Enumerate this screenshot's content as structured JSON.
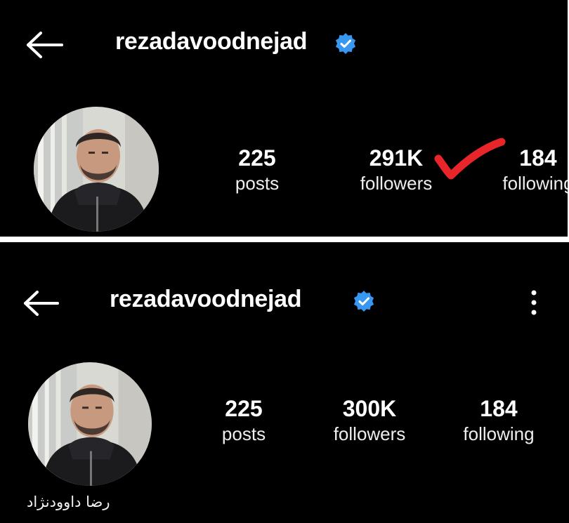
{
  "screens": [
    {
      "username": "rezadavoodnejad",
      "stats": [
        {
          "value": "225",
          "label": "posts"
        },
        {
          "value": "291K",
          "label": "followers"
        },
        {
          "value": "184",
          "label": "following"
        }
      ],
      "annotation_color": "#e8262a"
    },
    {
      "username": "rezadavoodnejad",
      "display_name": "رضا داوودنژاد",
      "stats": [
        {
          "value": "225",
          "label": "posts"
        },
        {
          "value": "300K",
          "label": "followers"
        },
        {
          "value": "184",
          "label": "following"
        }
      ]
    }
  ],
  "colors": {
    "background": "#000000",
    "text": "#ffffff",
    "verified_badge": "#3897f0",
    "separator": "#ffffff"
  },
  "icons": {
    "back": "back-arrow-icon",
    "verified": "verified-badge-icon",
    "more": "more-vertical-icon",
    "annotation": "red-checkmark-icon"
  }
}
